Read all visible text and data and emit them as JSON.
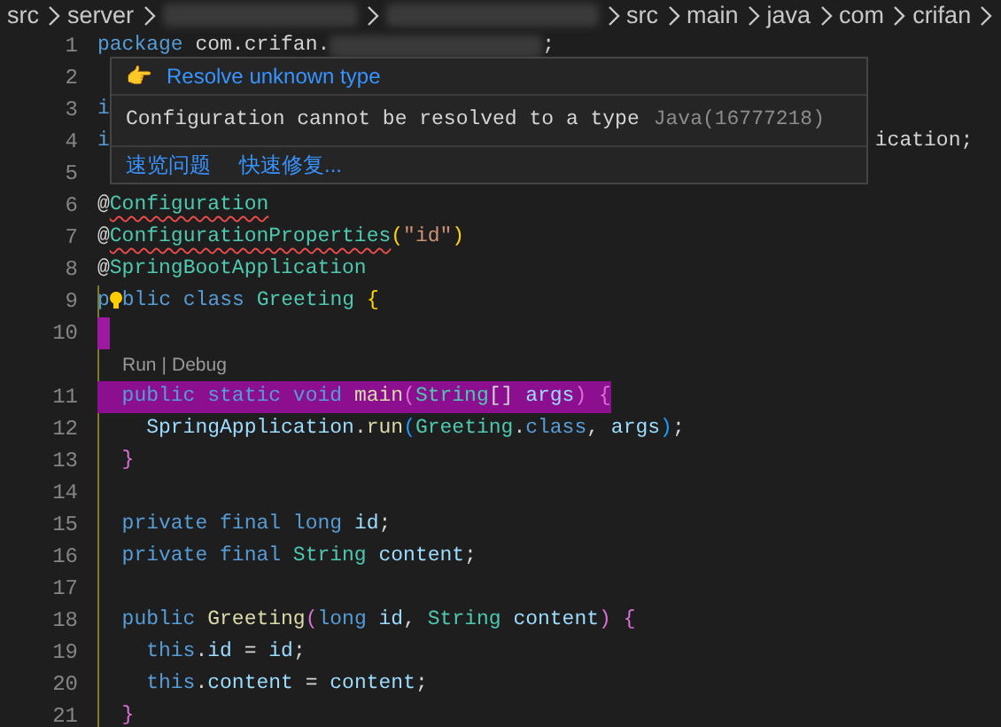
{
  "breadcrumb": [
    {
      "kind": "text",
      "label": "src"
    },
    {
      "kind": "text",
      "label": "server"
    },
    {
      "kind": "redacted"
    },
    {
      "kind": "redacted"
    },
    {
      "kind": "text",
      "label": "src"
    },
    {
      "kind": "text",
      "label": "main"
    },
    {
      "kind": "text",
      "label": "java"
    },
    {
      "kind": "text",
      "label": "com"
    },
    {
      "kind": "text",
      "label": "crifan"
    }
  ],
  "lines": [
    {
      "kind": "code",
      "number": "1",
      "tokens": [
        {
          "kind": "keyword",
          "text": "package"
        },
        {
          "kind": "plain",
          "text": " com.crifan."
        },
        {
          "kind": "redacted"
        },
        {
          "kind": "plain",
          "text": ";"
        }
      ]
    },
    {
      "kind": "code",
      "number": "2"
    },
    {
      "kind": "code",
      "number": "3",
      "tokens": [
        {
          "kind": "keyword",
          "text": "i"
        }
      ]
    },
    {
      "kind": "code",
      "number": "4",
      "tokens": [
        {
          "kind": "keyword",
          "text": "i"
        },
        {
          "kind": "tail",
          "text": "ication;"
        }
      ]
    },
    {
      "kind": "code",
      "number": "5"
    },
    {
      "kind": "code",
      "number": "6",
      "tokens": [
        {
          "kind": "plain",
          "text": "@"
        },
        {
          "kind": "type",
          "text": "Configuration",
          "error": true
        }
      ]
    },
    {
      "kind": "code",
      "number": "7",
      "tokens": [
        {
          "kind": "plain",
          "text": "@"
        },
        {
          "kind": "type",
          "text": "ConfigurationProperties",
          "error": true
        },
        {
          "kind": "bracket",
          "text": "("
        },
        {
          "kind": "string",
          "text": "\"id\""
        },
        {
          "kind": "bracket",
          "text": ")"
        }
      ]
    },
    {
      "kind": "code",
      "number": "8",
      "tokens": [
        {
          "kind": "plain",
          "text": "@"
        },
        {
          "kind": "type",
          "text": "SpringBootApplication"
        }
      ]
    },
    {
      "kind": "code",
      "number": "9",
      "tokens": [
        {
          "kind": "keyword",
          "text": "p"
        },
        {
          "kind": "lightbulb"
        },
        {
          "kind": "keyword",
          "text": "blic class "
        },
        {
          "kind": "type",
          "text": "Greeting "
        },
        {
          "kind": "bracket",
          "text": "{"
        }
      ]
    },
    {
      "kind": "code",
      "number": "10",
      "cursor": true
    },
    {
      "kind": "codelens",
      "links": [
        "Run",
        "Debug"
      ],
      "separator": "|"
    },
    {
      "kind": "code",
      "number": "11",
      "highlighted": true,
      "tokens": [
        {
          "kind": "keyword",
          "text": "  public static void "
        },
        {
          "kind": "func",
          "text": "main"
        },
        {
          "kind": "bracket2",
          "text": "("
        },
        {
          "kind": "type",
          "text": "String"
        },
        {
          "kind": "plain",
          "text": "[] "
        },
        {
          "kind": "var",
          "text": "args"
        },
        {
          "kind": "bracket2",
          "text": ") {"
        }
      ]
    },
    {
      "kind": "code",
      "number": "12",
      "tokens": [
        {
          "kind": "var",
          "text": "    SpringApplication"
        },
        {
          "kind": "plain",
          "text": "."
        },
        {
          "kind": "func",
          "text": "run"
        },
        {
          "kind": "bracket3",
          "text": "("
        },
        {
          "kind": "type",
          "text": "Greeting"
        },
        {
          "kind": "plain",
          "text": "."
        },
        {
          "kind": "keyword",
          "text": "class"
        },
        {
          "kind": "plain",
          "text": ", "
        },
        {
          "kind": "var",
          "text": "args"
        },
        {
          "kind": "bracket3",
          "text": ")"
        },
        {
          "kind": "plain",
          "text": ";"
        }
      ]
    },
    {
      "kind": "code",
      "number": "13",
      "tokens": [
        {
          "kind": "bracket2",
          "text": "  }"
        }
      ]
    },
    {
      "kind": "code",
      "number": "14"
    },
    {
      "kind": "code",
      "number": "15",
      "tokens": [
        {
          "kind": "keyword",
          "text": "  private final long "
        },
        {
          "kind": "var",
          "text": "id"
        },
        {
          "kind": "plain",
          "text": ";"
        }
      ]
    },
    {
      "kind": "code",
      "number": "16",
      "tokens": [
        {
          "kind": "keyword",
          "text": "  private final "
        },
        {
          "kind": "type",
          "text": "String "
        },
        {
          "kind": "var",
          "text": "content"
        },
        {
          "kind": "plain",
          "text": ";"
        }
      ]
    },
    {
      "kind": "code",
      "number": "17"
    },
    {
      "kind": "code",
      "number": "18",
      "tokens": [
        {
          "kind": "keyword",
          "text": "  public "
        },
        {
          "kind": "func",
          "text": "Greeting"
        },
        {
          "kind": "bracket2",
          "text": "("
        },
        {
          "kind": "keyword",
          "text": "long "
        },
        {
          "kind": "var",
          "text": "id"
        },
        {
          "kind": "plain",
          "text": ", "
        },
        {
          "kind": "type",
          "text": "String "
        },
        {
          "kind": "var",
          "text": "content"
        },
        {
          "kind": "bracket2",
          "text": ") {"
        }
      ]
    },
    {
      "kind": "code",
      "number": "19",
      "tokens": [
        {
          "kind": "keyword",
          "text": "    this"
        },
        {
          "kind": "plain",
          "text": "."
        },
        {
          "kind": "var",
          "text": "id"
        },
        {
          "kind": "plain",
          "text": " = "
        },
        {
          "kind": "var",
          "text": "id"
        },
        {
          "kind": "plain",
          "text": ";"
        }
      ]
    },
    {
      "kind": "code",
      "number": "20",
      "tokens": [
        {
          "kind": "keyword",
          "text": "    this"
        },
        {
          "kind": "plain",
          "text": "."
        },
        {
          "kind": "var",
          "text": "content"
        },
        {
          "kind": "plain",
          "text": " = "
        },
        {
          "kind": "var",
          "text": "content"
        },
        {
          "kind": "plain",
          "text": ";"
        }
      ]
    },
    {
      "kind": "code",
      "number": "21",
      "tokens": [
        {
          "kind": "bracket2",
          "text": "  }"
        }
      ]
    }
  ],
  "hover": {
    "fix_icon": "👉",
    "fix_title": "Resolve unknown type",
    "message": "Configuration cannot be resolved to a type",
    "source": "Java(16777218)",
    "actions": [
      "速览问题",
      "快速修复..."
    ]
  }
}
